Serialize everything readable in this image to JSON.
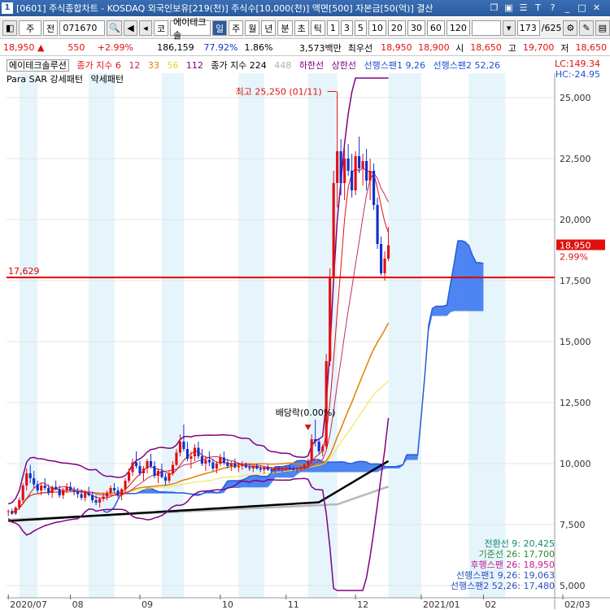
{
  "window": {
    "title": "[0601] 주식종합차트 - KOSDAQ 외국인보유[219(천)] 주식수[10,000(천)] 액면[500] 자본금[50(억)] 결산",
    "number": "1"
  },
  "toolbar": {
    "market": "주",
    "range": "전",
    "code": "071670",
    "type_label": "코",
    "name": "에이테크솔",
    "periods": [
      "일",
      "주",
      "월",
      "년",
      "분",
      "초",
      "틱"
    ],
    "selected_period": "일",
    "intervals": [
      "1",
      "3",
      "5",
      "10",
      "20",
      "30",
      "60",
      "120"
    ],
    "count": "173",
    "total": "/625"
  },
  "quote": {
    "price": "18,950",
    "arrow": "▲",
    "change": "550",
    "change_pct": "+2.99%",
    "volume": "186,159",
    "vol_ratio": "77.92%",
    "turnover": "1.86%",
    "amount": "3,573백만",
    "best_label": "최우선",
    "ask": "18,950",
    "bid": "18,900",
    "open_label": "시",
    "open": "18,650",
    "high_label": "고",
    "high": "19,700",
    "low_label": "저",
    "low": "18,650"
  },
  "legend": {
    "name": "에이테크솔루션",
    "ma_label": "종가 지수 6",
    "ma12": "12",
    "ma33": "33",
    "ma56": "56",
    "ma112": "112",
    "ma224": "종가 지수 224",
    "ma448": "448",
    "lower": "하한선",
    "upper": "상한선",
    "span1": "선행스팬1 9,26",
    "span2": "선행스팬2 52,26",
    "sar": "Para SAR 강세패턴",
    "sar2": "약세패턴",
    "lc": "LC:149.34",
    "hc": "HC:-24.95"
  },
  "colors": {
    "candle_up": "#e01010",
    "candle_down": "#1030d0",
    "ma6": "#e01010",
    "ma12": "#c03060",
    "ma33": "#e08000",
    "ma56": "#f0e040",
    "ma112": "#800080",
    "ma224": "#000000",
    "ma448": "#b8b8b8",
    "cloud": "#3070f0",
    "hline": "#e00000",
    "band": "#800080"
  },
  "chart_data": {
    "type": "candlestick",
    "ylim": [
      4500,
      26000
    ],
    "yticks": [
      5000,
      7500,
      10000,
      12500,
      15000,
      17500,
      20000,
      22500,
      25000
    ],
    "ytick_labels": [
      "5,000",
      "7,500",
      "10,000",
      "12,500",
      "15,000",
      "17,500",
      "20,000",
      "22,500",
      "25,000"
    ],
    "x_labels": [
      "2020/07",
      "08",
      "09",
      "10",
      "11",
      "12",
      "2021/01",
      "02",
      "02/03"
    ],
    "hline_value": 17629,
    "hline_label": "17,629",
    "price_tag": "18,950",
    "price_tag_pct": "2.99%",
    "annotations": [
      {
        "text": "최고 25,250 (01/11)",
        "value": 25250
      },
      {
        "text": "배당락(0.00%)",
        "value": 11700
      }
    ],
    "readout": [
      {
        "label": "전환선 9: 20,425",
        "color": "#0a8a6a"
      },
      {
        "label": "기준선 26: 17,700",
        "color": "#2a8a3a"
      },
      {
        "label": "후행스팬 26: 18,950",
        "color": "#c02090"
      },
      {
        "label": "선행스팬1 9,26: 19,063",
        "color": "#3050c0"
      },
      {
        "label": "선행스팬2 52,26: 17,480",
        "color": "#3050c0"
      }
    ],
    "candles": [
      [
        8020,
        8120,
        7850,
        8050
      ],
      [
        8050,
        8150,
        7900,
        7950
      ],
      [
        7950,
        8250,
        7900,
        8200
      ],
      [
        8200,
        8600,
        8100,
        8500
      ],
      [
        8500,
        9200,
        8400,
        9100
      ],
      [
        9100,
        9800,
        8900,
        9600
      ],
      [
        9600,
        9950,
        9200,
        9400
      ],
      [
        9400,
        9700,
        9000,
        9150
      ],
      [
        9150,
        9300,
        8800,
        8900
      ],
      [
        8900,
        9200,
        8700,
        9100
      ],
      [
        9100,
        9400,
        8900,
        9000
      ],
      [
        9000,
        9150,
        8700,
        8800
      ],
      [
        8800,
        9100,
        8600,
        9050
      ],
      [
        9050,
        9300,
        8900,
        8950
      ],
      [
        8950,
        9100,
        8600,
        8700
      ],
      [
        8700,
        9000,
        8550,
        8900
      ],
      [
        8900,
        9200,
        8800,
        9050
      ],
      [
        9050,
        9250,
        8850,
        8900
      ],
      [
        8900,
        9050,
        8700,
        8850
      ],
      [
        8850,
        9000,
        8600,
        8750
      ],
      [
        8750,
        8950,
        8500,
        8600
      ],
      [
        8600,
        8900,
        8450,
        8800
      ],
      [
        8800,
        9050,
        8650,
        8700
      ],
      [
        8700,
        8850,
        8400,
        8500
      ],
      [
        8500,
        8700,
        8300,
        8400
      ],
      [
        8400,
        8600,
        8200,
        8550
      ],
      [
        8550,
        8800,
        8450,
        8650
      ],
      [
        8650,
        8900,
        8500,
        8800
      ],
      [
        8800,
        9100,
        8700,
        9000
      ],
      [
        9000,
        9200,
        8800,
        8900
      ],
      [
        8900,
        9050,
        8600,
        8700
      ],
      [
        8700,
        9000,
        8500,
        8950
      ],
      [
        8950,
        9400,
        8800,
        9300
      ],
      [
        9300,
        9800,
        9200,
        9650
      ],
      [
        9650,
        10200,
        9500,
        10050
      ],
      [
        10050,
        10500,
        9800,
        9900
      ],
      [
        9900,
        10100,
        9500,
        9600
      ],
      [
        9600,
        9900,
        9300,
        9800
      ],
      [
        9800,
        10200,
        9600,
        10100
      ],
      [
        10100,
        10400,
        9800,
        9900
      ],
      [
        9900,
        10100,
        9400,
        9500
      ],
      [
        9500,
        9800,
        9200,
        9700
      ],
      [
        9700,
        10000,
        9400,
        9450
      ],
      [
        9450,
        9600,
        9100,
        9300
      ],
      [
        9300,
        9700,
        9200,
        9600
      ],
      [
        9600,
        10100,
        9500,
        9950
      ],
      [
        9950,
        10600,
        9900,
        10450
      ],
      [
        10450,
        11200,
        10300,
        10900
      ],
      [
        10900,
        11600,
        10500,
        10600
      ],
      [
        10600,
        10900,
        10100,
        10200
      ],
      [
        10200,
        10500,
        9800,
        10300
      ],
      [
        10300,
        10800,
        10100,
        10650
      ],
      [
        10650,
        10900,
        10200,
        10300
      ],
      [
        10300,
        10600,
        9900,
        10000
      ],
      [
        10000,
        10300,
        9700,
        10150
      ],
      [
        10150,
        10500,
        9900,
        10050
      ],
      [
        10050,
        10200,
        9700,
        9800
      ],
      [
        9800,
        10100,
        9600,
        10000
      ],
      [
        10000,
        10400,
        9900,
        10250
      ],
      [
        10250,
        10500,
        9950,
        10050
      ],
      [
        10050,
        10200,
        9800,
        9900
      ],
      [
        9900,
        10100,
        9700,
        10000
      ],
      [
        10000,
        10200,
        9800,
        9850
      ],
      [
        9850,
        10000,
        9650,
        9900
      ],
      [
        9900,
        10100,
        9750,
        9950
      ],
      [
        9950,
        10050,
        9800,
        9850
      ],
      [
        9850,
        9950,
        9700,
        9800
      ],
      [
        9800,
        9950,
        9650,
        9900
      ],
      [
        9900,
        10000,
        9750,
        9800
      ],
      [
        9800,
        9900,
        9650,
        9750
      ],
      [
        9750,
        9900,
        9600,
        9850
      ],
      [
        9850,
        9950,
        9700,
        9750
      ],
      [
        9750,
        9850,
        9600,
        9700
      ],
      [
        9700,
        9850,
        9600,
        9800
      ],
      [
        9800,
        9900,
        9700,
        9750
      ],
      [
        9750,
        9850,
        9650,
        9800
      ],
      [
        9800,
        9900,
        9700,
        9850
      ],
      [
        9850,
        9950,
        9750,
        9800
      ],
      [
        9800,
        9900,
        9700,
        9750
      ],
      [
        9750,
        9850,
        9650,
        9800
      ],
      [
        9800,
        9900,
        9700,
        9850
      ],
      [
        9850,
        10000,
        9750,
        9950
      ],
      [
        9950,
        10200,
        9850,
        10100
      ],
      [
        10100,
        11200,
        10000,
        11000
      ],
      [
        11000,
        11800,
        10700,
        10900
      ],
      [
        10900,
        11000,
        10400,
        10500
      ],
      [
        10500,
        10800,
        10300,
        10700
      ],
      [
        10700,
        14500,
        10600,
        14200
      ],
      [
        14200,
        18000,
        14000,
        17600
      ],
      [
        17600,
        22000,
        17500,
        21500
      ],
      [
        21500,
        25250,
        20500,
        22800
      ],
      [
        22800,
        23300,
        21000,
        21500
      ],
      [
        21500,
        22900,
        20800,
        22500
      ],
      [
        22500,
        23100,
        21800,
        22000
      ],
      [
        22000,
        22700,
        20900,
        21200
      ],
      [
        21200,
        22800,
        21000,
        22600
      ],
      [
        22600,
        23400,
        21900,
        22100
      ],
      [
        22100,
        22700,
        21400,
        22400
      ],
      [
        22400,
        22900,
        21200,
        21600
      ],
      [
        21600,
        22500,
        20800,
        22000
      ],
      [
        22000,
        22300,
        20400,
        20600
      ],
      [
        20600,
        20900,
        18800,
        19000
      ],
      [
        19000,
        19300,
        17700,
        17800
      ],
      [
        17800,
        18700,
        17500,
        18400
      ],
      [
        18400,
        19700,
        18300,
        18950
      ]
    ],
    "x_ticks_at": [
      0,
      17,
      36,
      58,
      76,
      95,
      113,
      130,
      146
    ],
    "total_bars": 150
  }
}
